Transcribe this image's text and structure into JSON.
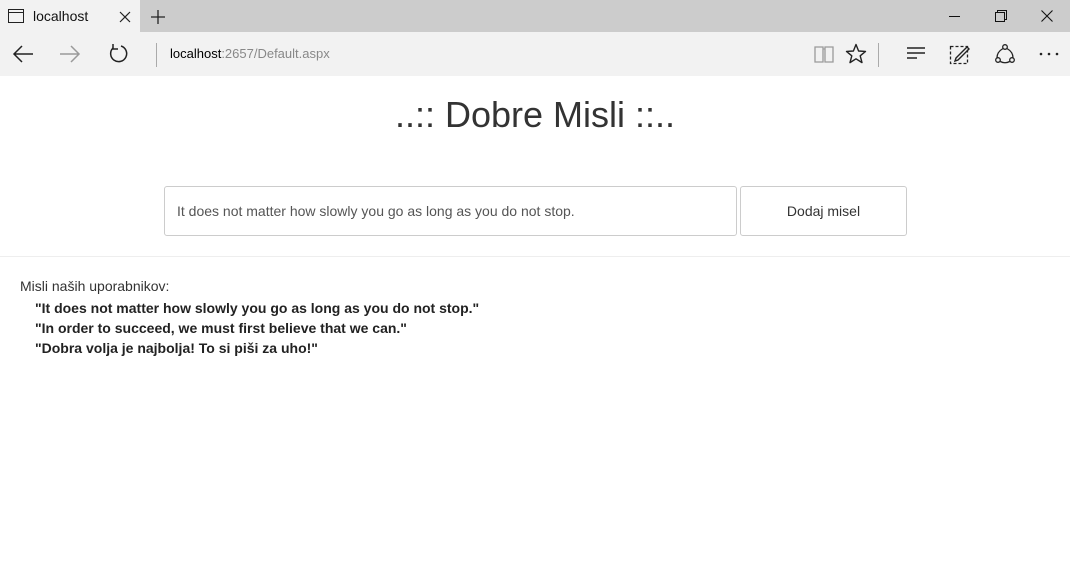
{
  "browser": {
    "tab_title": "localhost",
    "url_host": "localhost",
    "url_rest": ":2657/Default.aspx"
  },
  "page": {
    "title": "..:: Dobre Misli ::..",
    "input_value": "It does not matter how slowly you go as long as you do not stop.",
    "add_button_label": "Dodaj misel",
    "thoughts_heading": "Misli naših uporabnikov:",
    "thoughts": [
      "\"It does not matter how slowly you go as long as you do not stop.\"",
      "\"In order to succeed, we must first believe that we can.\"",
      "\"Dobra volja je najbolja! To si piši za uho!\""
    ]
  }
}
